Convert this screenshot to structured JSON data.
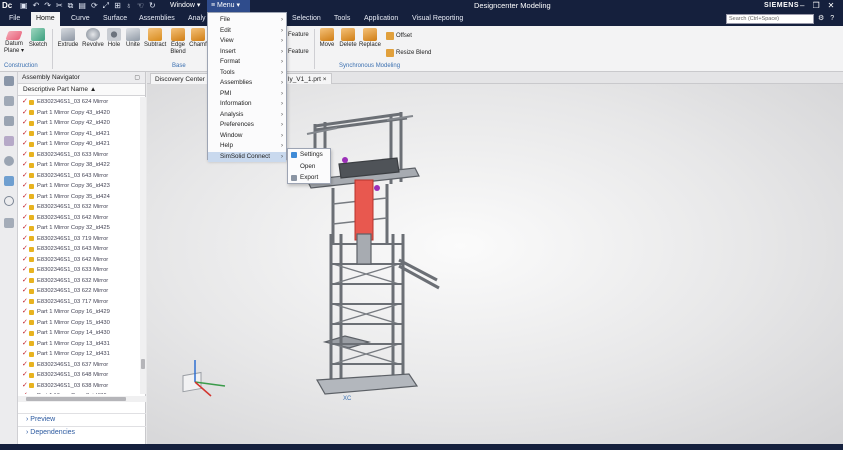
{
  "titlebar": {
    "logo": "Dc",
    "window_menu": "Window ▾",
    "menu_button": "≡ Menu ▾",
    "app_title": "Designcenter Modeling",
    "brand": "SIEMENS"
  },
  "tabs": [
    {
      "label": "File",
      "active": false
    },
    {
      "label": "Home",
      "active": true
    },
    {
      "label": "Curve",
      "active": false
    },
    {
      "label": "Surface",
      "active": false
    },
    {
      "label": "Assemblies",
      "active": false
    },
    {
      "label": "Analy",
      "active": false
    },
    {
      "label": "Selection",
      "active": false
    },
    {
      "label": "Tools",
      "active": false
    },
    {
      "label": "Application",
      "active": false
    },
    {
      "label": "Visual Reporting",
      "active": false
    }
  ],
  "search": {
    "placeholder": "Search (Ctrl+Space)"
  },
  "ribbon": {
    "datum_plane": "Datum\nPlane ▾",
    "sketch": "Sketch",
    "extrude": "Extrude",
    "revolve": "Revolve",
    "hole": "Hole",
    "unite": "Unite",
    "subtract": "Subtract",
    "edge_blend": "Edge\nBlend",
    "chamfer": "Chamf",
    "feature1": "Feature",
    "feature2": "Feature",
    "move": "Move",
    "delete": "Delete",
    "replace": "Replace",
    "offset": "Offset",
    "resize_blend": "Resize Blend",
    "group_construction": "Construction",
    "group_base": "Base",
    "group_sync": "Synchronous Modeling"
  },
  "navigator": {
    "title": "Assembly Navigator",
    "column": "Descriptive Part Name",
    "rows": [
      "E8302346S1_03 624 Mirror",
      "Part 1 Mirror Copy 43_id420",
      "Part 1 Mirror Copy 42_id420",
      "Part 1 Mirror Copy 41_id421",
      "Part 1 Mirror Copy 40_id421",
      "E8302346S1_03 633 Mirror",
      "Part 1 Mirror Copy 38_id422",
      "E8302346S1_03 643 Mirror",
      "Part 1 Mirror Copy 36_id423",
      "Part 1 Mirror Copy 35_id424",
      "E8302346S1_03 632 Mirror",
      "E8302346S1_03 642 Mirror",
      "Part 1 Mirror Copy 32_id425",
      "E8302346S1_03 719 Mirror",
      "E8302346S1_03 643 Mirror",
      "E8302346S1_03 642 Mirror",
      "E8302346S1_03 633 Mirror",
      "E8302346S1_03 632 Mirror",
      "E8302346S1_03 622 Mirror",
      "E8302346S1_03 717 Mirror",
      "Part 1 Mirror Copy 16_id429",
      "Part 1 Mirror Copy 15_id430",
      "Part 1 Mirror Copy 14_id430",
      "Part 1 Mirror Copy 13_id431",
      "Part 1 Mirror Copy 12_id431",
      "E8302346S1_03 637 Mirror",
      "E8302346S1_03 648 Mirror",
      "E8302346S1_03 638 Mirror",
      "Part 1 Mirror Copy 8_id436"
    ],
    "preview": "Preview",
    "dependencies": "Dependencies"
  },
  "doctabs": {
    "tab1": "Discovery Center",
    "tab2": "ly_V1_1.prt",
    "close": "×"
  },
  "main_menu": {
    "items": [
      {
        "label": "File",
        "arrow": "›"
      },
      {
        "label": "Edit",
        "arrow": "›"
      },
      {
        "label": "View",
        "arrow": "›"
      },
      {
        "label": "Insert",
        "arrow": "›"
      },
      {
        "label": "Format",
        "arrow": "›"
      },
      {
        "label": "Tools",
        "arrow": "›"
      },
      {
        "label": "Assemblies",
        "arrow": "›"
      },
      {
        "label": "PMI",
        "arrow": "›"
      },
      {
        "label": "Information",
        "arrow": "›"
      },
      {
        "label": "Analysis",
        "arrow": "›"
      },
      {
        "label": "Preferences",
        "arrow": "›"
      },
      {
        "label": "Window",
        "arrow": "›"
      },
      {
        "label": "Help",
        "arrow": "›"
      },
      {
        "label": "SimSolid Connect",
        "arrow": "›"
      }
    ]
  },
  "sub_menu": {
    "items": [
      "Settings",
      "Open",
      "Export"
    ]
  },
  "viewport": {
    "axis_label": "XC"
  },
  "colors": {
    "dark_navy": "#15203d",
    "menu_highlight": "#c9d9ee",
    "accent_red": "#e8584f",
    "link_blue": "#2c5aa0"
  }
}
